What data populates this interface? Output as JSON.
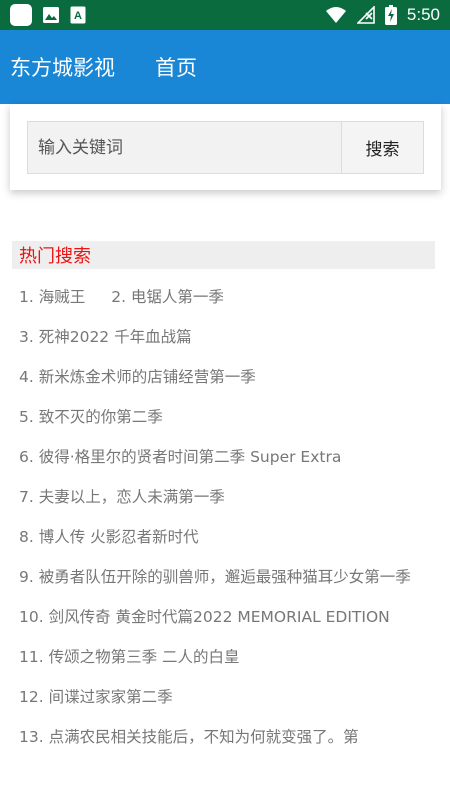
{
  "status_bar": {
    "time": "5:50",
    "icons": [
      "app-square-icon",
      "image-icon",
      "text-a-icon",
      "wifi-icon",
      "signal-icon",
      "battery-charging-icon"
    ]
  },
  "app_bar": {
    "title": "东方城影视",
    "nav_home": "首页",
    "color": "#1a87d6"
  },
  "search": {
    "placeholder": "输入关键词",
    "button_label": "搜索"
  },
  "hot": {
    "header": "热门搜索",
    "header_color": "#ee1111",
    "items": [
      "1. 海贼王",
      "2. 电锯人第一季",
      "3. 死神2022 千年血战篇",
      "4. 新米炼金术师的店铺经营第一季",
      "5. 致不灭的你第二季",
      "6. 彼得·格里尔的贤者时间第二季 Super Extra",
      "7. 夫妻以上，恋人未满第一季",
      "8. 博人传 火影忍者新时代",
      "9. 被勇者队伍开除的驯兽师，邂逅最强种猫耳少女第一季",
      "10. 剑风传奇 黄金时代篇2022 MEMORIAL EDITION",
      "11. 传颂之物第三季 二人的白皇",
      "12. 间谍过家家第二季",
      "13. 点满农民相关技能后，不知为何就变强了。第"
    ]
  }
}
